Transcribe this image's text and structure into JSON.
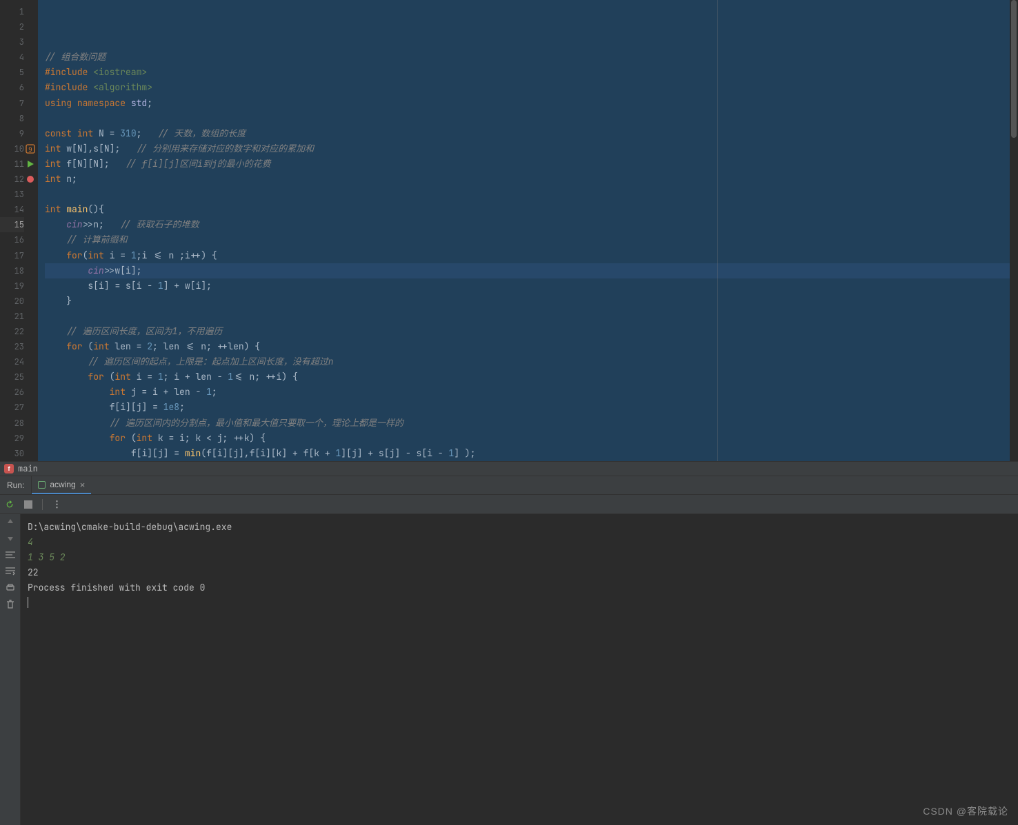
{
  "gutter": {
    "first_line": 1,
    "last_line": 30,
    "highlighted_line": 15,
    "icons": {
      "10": "bookmark-9",
      "11": "run-play",
      "12": "breakpoint"
    }
  },
  "breadcrumb": {
    "icon_letter": "f",
    "label": "main"
  },
  "run": {
    "title": "Run:",
    "tab_name": "acwing",
    "tab_close": "×"
  },
  "console": {
    "cmd": "D:\\acwing\\cmake-build-debug\\acwing.exe",
    "inputs": [
      "4",
      "1 3 5 2"
    ],
    "outputs": [
      "22"
    ],
    "exit": "Process finished with exit code 0"
  },
  "watermark": "CSDN @客院载论",
  "code": {
    "1": [
      [
        "comment",
        "// 组合数问题"
      ]
    ],
    "2": [
      [
        "pp",
        "#include "
      ],
      [
        "pp-inc",
        "<iostream>"
      ]
    ],
    "3": [
      [
        "pp",
        "#include "
      ],
      [
        "pp-inc",
        "<algorithm>"
      ]
    ],
    "4": [
      [
        "kw",
        "using "
      ],
      [
        "kw",
        "namespace "
      ],
      [
        "ns",
        "std"
      ],
      [
        "op",
        ";"
      ]
    ],
    "5": [],
    "6": [
      [
        "kw",
        "const "
      ],
      [
        "type",
        "int "
      ],
      [
        "var",
        "N "
      ],
      [
        "op",
        "= "
      ],
      [
        "num",
        "310"
      ],
      [
        "op",
        ";   "
      ],
      [
        "comment",
        "// 天数，数组的长度"
      ]
    ],
    "7": [
      [
        "type",
        "int "
      ],
      [
        "var",
        "w"
      ],
      [
        "op",
        "["
      ],
      [
        "var",
        "N"
      ],
      [
        "op",
        "],"
      ],
      [
        "var",
        "s"
      ],
      [
        "op",
        "["
      ],
      [
        "var",
        "N"
      ],
      [
        "op",
        "];   "
      ],
      [
        "comment",
        "// 分别用来存储对应的数字和对应的累加和"
      ]
    ],
    "8": [
      [
        "type",
        "int "
      ],
      [
        "var",
        "f"
      ],
      [
        "op",
        "["
      ],
      [
        "var",
        "N"
      ],
      [
        "op",
        "]["
      ],
      [
        "var",
        "N"
      ],
      [
        "op",
        "];   "
      ],
      [
        "comment",
        "// f[i][j]区间i到j的最小的花费"
      ]
    ],
    "9": [
      [
        "type",
        "int "
      ],
      [
        "var",
        "n"
      ],
      [
        "op",
        ";"
      ]
    ],
    "10": [],
    "11": [
      [
        "type",
        "int "
      ],
      [
        "func",
        "main"
      ],
      [
        "op",
        "(){"
      ]
    ],
    "12": [
      [
        "op",
        "    "
      ],
      [
        "global",
        "cin"
      ],
      [
        "op",
        ">>"
      ],
      [
        "var",
        "n"
      ],
      [
        "op",
        ";   "
      ],
      [
        "comment",
        "// 获取石子的堆数"
      ]
    ],
    "13": [
      [
        "op",
        "    "
      ],
      [
        "comment",
        "// 计算前缀和"
      ]
    ],
    "14": [
      [
        "op",
        "    "
      ],
      [
        "kw",
        "for"
      ],
      [
        "op",
        "("
      ],
      [
        "type",
        "int "
      ],
      [
        "var",
        "i "
      ],
      [
        "op",
        "= "
      ],
      [
        "num",
        "1"
      ],
      [
        "op",
        ";"
      ],
      [
        "var",
        "i "
      ],
      [
        "op",
        "<= "
      ],
      [
        "var",
        "n "
      ],
      [
        "op",
        ";"
      ],
      [
        "var",
        "i"
      ],
      [
        "op",
        "++"
      ],
      [
        "op",
        ") {"
      ]
    ],
    "15": [
      [
        "op",
        "        "
      ],
      [
        "global",
        "cin"
      ],
      [
        "op",
        ">>"
      ],
      [
        "var",
        "w"
      ],
      [
        "op",
        "["
      ],
      [
        "var",
        "i"
      ],
      [
        "op",
        "];"
      ]
    ],
    "16": [
      [
        "op",
        "        "
      ],
      [
        "var",
        "s"
      ],
      [
        "op",
        "["
      ],
      [
        "var",
        "i"
      ],
      [
        "op",
        "] = "
      ],
      [
        "var",
        "s"
      ],
      [
        "op",
        "["
      ],
      [
        "var",
        "i "
      ],
      [
        "op",
        "- "
      ],
      [
        "num",
        "1"
      ],
      [
        "op",
        "] + "
      ],
      [
        "var",
        "w"
      ],
      [
        "op",
        "["
      ],
      [
        "var",
        "i"
      ],
      [
        "op",
        "];"
      ]
    ],
    "17": [
      [
        "op",
        "    }"
      ]
    ],
    "18": [],
    "19": [
      [
        "op",
        "    "
      ],
      [
        "comment",
        "// 遍历区间长度，区间为1，不用遍历"
      ]
    ],
    "20": [
      [
        "op",
        "    "
      ],
      [
        "kw",
        "for "
      ],
      [
        "op",
        "("
      ],
      [
        "type",
        "int "
      ],
      [
        "var",
        "len "
      ],
      [
        "op",
        "= "
      ],
      [
        "num",
        "2"
      ],
      [
        "op",
        "; "
      ],
      [
        "var",
        "len "
      ],
      [
        "op",
        "<= "
      ],
      [
        "var",
        "n"
      ],
      [
        "op",
        "; ++"
      ],
      [
        "var",
        "len"
      ],
      [
        "op",
        ") {"
      ]
    ],
    "21": [
      [
        "op",
        "        "
      ],
      [
        "comment",
        "// 遍历区间的起点，上限是：起点加上区间长度，没有超过n"
      ]
    ],
    "22": [
      [
        "op",
        "        "
      ],
      [
        "kw",
        "for "
      ],
      [
        "op",
        "("
      ],
      [
        "type",
        "int "
      ],
      [
        "var",
        "i "
      ],
      [
        "op",
        "= "
      ],
      [
        "num",
        "1"
      ],
      [
        "op",
        "; "
      ],
      [
        "var",
        "i "
      ],
      [
        "op",
        "+ "
      ],
      [
        "var",
        "len "
      ],
      [
        "op",
        "- "
      ],
      [
        "num",
        "1"
      ],
      [
        "op",
        "<= "
      ],
      [
        "var",
        "n"
      ],
      [
        "op",
        "; ++"
      ],
      [
        "var",
        "i"
      ],
      [
        "op",
        ") {"
      ]
    ],
    "23": [
      [
        "op",
        "            "
      ],
      [
        "type",
        "int "
      ],
      [
        "var",
        "j "
      ],
      [
        "op",
        "= "
      ],
      [
        "var",
        "i "
      ],
      [
        "op",
        "+ "
      ],
      [
        "var",
        "len "
      ],
      [
        "op",
        "- "
      ],
      [
        "num",
        "1"
      ],
      [
        "op",
        ";"
      ]
    ],
    "24": [
      [
        "op",
        "            "
      ],
      [
        "var",
        "f"
      ],
      [
        "op",
        "["
      ],
      [
        "var",
        "i"
      ],
      [
        "op",
        "]["
      ],
      [
        "var",
        "j"
      ],
      [
        "op",
        "] = "
      ],
      [
        "num",
        "1e8"
      ],
      [
        "op",
        ";"
      ]
    ],
    "25": [
      [
        "op",
        "            "
      ],
      [
        "comment",
        "// 遍历区间内的分割点，最小值和最大值只要取一个，理论上都是一样的"
      ]
    ],
    "26": [
      [
        "op",
        "            "
      ],
      [
        "kw",
        "for "
      ],
      [
        "op",
        "("
      ],
      [
        "type",
        "int "
      ],
      [
        "var",
        "k "
      ],
      [
        "op",
        "= "
      ],
      [
        "var",
        "i"
      ],
      [
        "op",
        "; "
      ],
      [
        "var",
        "k "
      ],
      [
        "op",
        "< "
      ],
      [
        "var",
        "j"
      ],
      [
        "op",
        "; ++"
      ],
      [
        "var",
        "k"
      ],
      [
        "op",
        ") {"
      ]
    ],
    "27": [
      [
        "op",
        "                "
      ],
      [
        "var",
        "f"
      ],
      [
        "op",
        "["
      ],
      [
        "var",
        "i"
      ],
      [
        "op",
        "]["
      ],
      [
        "var",
        "j"
      ],
      [
        "op",
        "] = "
      ],
      [
        "func",
        "min"
      ],
      [
        "op",
        "("
      ],
      [
        "var",
        "f"
      ],
      [
        "op",
        "["
      ],
      [
        "var",
        "i"
      ],
      [
        "op",
        "]["
      ],
      [
        "var",
        "j"
      ],
      [
        "op",
        "],"
      ],
      [
        "var",
        "f"
      ],
      [
        "op",
        "["
      ],
      [
        "var",
        "i"
      ],
      [
        "op",
        "]["
      ],
      [
        "var",
        "k"
      ],
      [
        "op",
        "] + "
      ],
      [
        "var",
        "f"
      ],
      [
        "op",
        "["
      ],
      [
        "var",
        "k "
      ],
      [
        "op",
        "+ "
      ],
      [
        "num",
        "1"
      ],
      [
        "op",
        "]["
      ],
      [
        "var",
        "j"
      ],
      [
        "op",
        "] + "
      ],
      [
        "var",
        "s"
      ],
      [
        "op",
        "["
      ],
      [
        "var",
        "j"
      ],
      [
        "op",
        "] - "
      ],
      [
        "var",
        "s"
      ],
      [
        "op",
        "["
      ],
      [
        "var",
        "i "
      ],
      [
        "op",
        "- "
      ],
      [
        "num",
        "1"
      ],
      [
        "op",
        "] );"
      ]
    ],
    "28": [
      [
        "op",
        "            }"
      ]
    ],
    "29": [
      [
        "op",
        "        }"
      ]
    ],
    "30": [
      [
        "op",
        "    }"
      ]
    ]
  }
}
